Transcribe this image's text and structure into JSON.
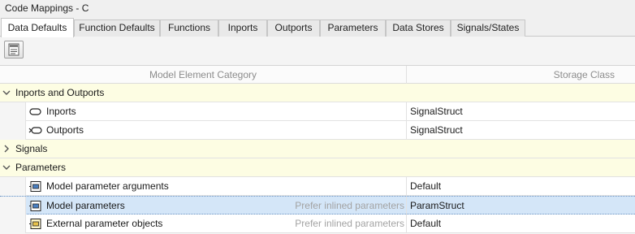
{
  "window": {
    "title": "Code Mappings - C"
  },
  "tabs": [
    {
      "label": "Data Defaults",
      "active": true
    },
    {
      "label": "Function Defaults",
      "active": false
    },
    {
      "label": "Functions",
      "active": false
    },
    {
      "label": "Inports",
      "active": false
    },
    {
      "label": "Outports",
      "active": false
    },
    {
      "label": "Parameters",
      "active": false
    },
    {
      "label": "Data Stores",
      "active": false
    },
    {
      "label": "Signals/States",
      "active": false
    }
  ],
  "toolbar": {
    "icon": "properties-icon"
  },
  "columns": {
    "category": "Model Element Category",
    "storage": "Storage Class"
  },
  "groups": {
    "io": {
      "label": "Inports and Outports",
      "expanded": true
    },
    "signals": {
      "label": "Signals",
      "expanded": false
    },
    "parameters": {
      "label": "Parameters",
      "expanded": true
    }
  },
  "items": {
    "inports": {
      "label": "Inports",
      "storage": "SignalStruct",
      "icon": "inport-icon"
    },
    "outports": {
      "label": "Outports",
      "storage": "SignalStruct",
      "icon": "outport-icon"
    },
    "model_param_args": {
      "label": "Model parameter arguments",
      "storage": "Default",
      "icon": "parameter-block-icon"
    },
    "model_params": {
      "label": "Model parameters",
      "hint": "Prefer inlined parameters",
      "storage": "ParamStruct",
      "icon": "parameter-block-icon",
      "selected": true
    },
    "external_params": {
      "label": "External parameter objects",
      "hint": "Prefer inlined parameters",
      "storage": "Default",
      "icon": "external-parameter-icon"
    }
  },
  "colors": {
    "group_bg": "#fdfde3",
    "selected_bg": "#d4e6f8",
    "hint_text": "#a3a3a3"
  }
}
